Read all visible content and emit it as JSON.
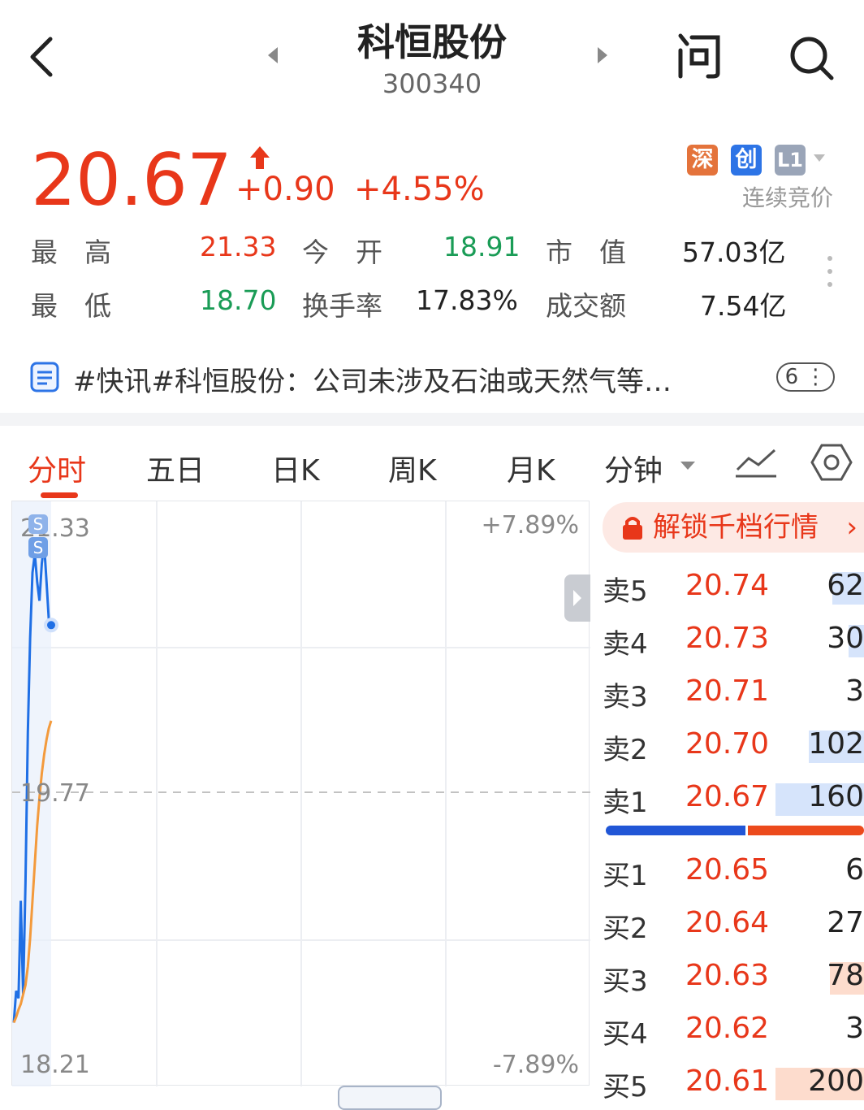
{
  "header": {
    "back_icon": "chevron-left-icon",
    "title": "科恒股份",
    "code": "300340",
    "ask_icon": "question-icon",
    "search_icon": "search-icon"
  },
  "quote": {
    "price": "20.67",
    "change": "+0.90",
    "change_pct": "+4.55%",
    "up_arrow_icon": "up-arrow-icon",
    "badges": [
      "深",
      "创",
      "L1"
    ],
    "auction_label": "连续竞价",
    "stats": {
      "high_label": "最　高",
      "high": "21.33",
      "open_label": "今　开",
      "open": "18.91",
      "mktcap_label": "市　值",
      "mktcap": "57.03亿",
      "low_label": "最　低",
      "low": "18.70",
      "turnover_label": "换手率",
      "turnover": "17.83%",
      "amount_label": "成交额",
      "amount": "7.54亿"
    }
  },
  "news": {
    "text": "#快讯#科恒股份：公司未涉及石油或天然气等…",
    "count": "6"
  },
  "tabs": [
    "分时",
    "五日",
    "日K",
    "周K",
    "月K",
    "分钟"
  ],
  "chart": {
    "top_price": "21.33",
    "mid_price": "19.77",
    "bottom_price": "18.21",
    "top_pct": "+7.89%",
    "bottom_pct": "-7.89%",
    "marker_label": "S"
  },
  "chart_data": {
    "type": "line",
    "ylim": [
      18.21,
      21.33
    ],
    "reference": 19.77,
    "series": [
      {
        "values": [
          18.55,
          18.72,
          18.68,
          19.2,
          18.7,
          19.3,
          20.1,
          20.6,
          20.95,
          21.05,
          20.9,
          20.8,
          21.0,
          21.1,
          20.9,
          20.7,
          20.67
        ]
      },
      {
        "values": [
          18.55,
          18.58,
          18.62,
          18.65,
          18.7,
          18.75,
          18.85,
          19.0,
          19.2,
          19.4,
          19.6,
          19.75,
          19.88,
          19.98,
          20.06,
          20.12,
          20.16
        ]
      }
    ],
    "colors": [
      "#1f6fe5",
      "#f39a3c"
    ]
  },
  "orderbook": {
    "unlock_label": "解锁千档行情",
    "sell": [
      {
        "label": "卖5",
        "price": "20.74",
        "vol": "62",
        "frac": 0.12
      },
      {
        "label": "卖4",
        "price": "20.73",
        "vol": "30",
        "frac": 0.06
      },
      {
        "label": "卖3",
        "price": "20.71",
        "vol": "3",
        "frac": 0.0
      },
      {
        "label": "卖2",
        "price": "20.70",
        "vol": "102",
        "frac": 0.21
      },
      {
        "label": "卖1",
        "price": "20.67",
        "vol": "160",
        "frac": 0.34
      }
    ],
    "buy": [
      {
        "label": "买1",
        "price": "20.65",
        "vol": "6",
        "frac": 0.0
      },
      {
        "label": "买2",
        "price": "20.64",
        "vol": "27",
        "frac": 0.0
      },
      {
        "label": "买3",
        "price": "20.63",
        "vol": "78",
        "frac": 0.13
      },
      {
        "label": "买4",
        "price": "20.62",
        "vol": "3",
        "frac": 0.0
      },
      {
        "label": "买5",
        "price": "20.61",
        "vol": "200",
        "frac": 0.34
      }
    ],
    "sell_color": "#d6e4fb",
    "buy_color": "#fddccd",
    "ratio_buy": 0.54
  }
}
